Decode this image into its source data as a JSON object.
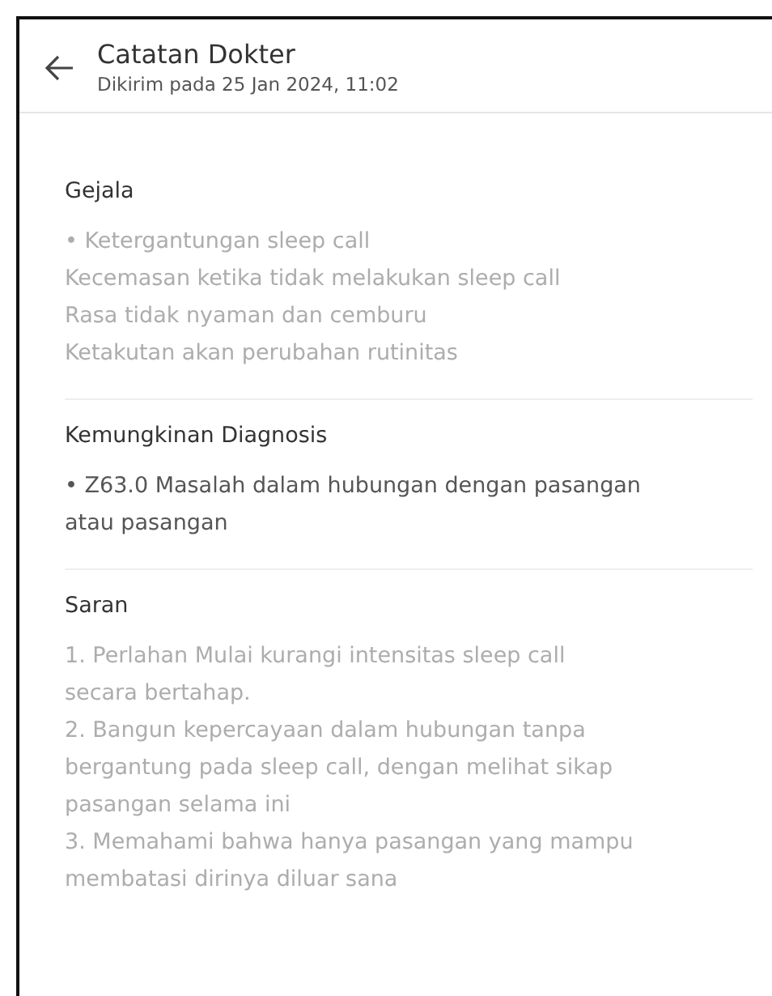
{
  "header": {
    "title": "Catatan Dokter",
    "subtitle": "Dikirim pada 25 Jan 2024, 11:02"
  },
  "sections": [
    {
      "title": "Gejala",
      "muted": true,
      "lines": [
        "• Ketergantungan sleep call",
        "Kecemasan ketika tidak melakukan sleep call",
        "Rasa tidak nyaman dan cemburu",
        "Ketakutan akan perubahan rutinitas"
      ]
    },
    {
      "title": "Kemungkinan Diagnosis",
      "muted": false,
      "lines": [
        "• Z63.0 Masalah dalam hubungan dengan pasangan",
        "atau pasangan"
      ]
    },
    {
      "title": "Saran",
      "muted": true,
      "lines": [
        "1. Perlahan Mulai kurangi intensitas sleep call",
        "secara bertahap.",
        "2. Bangun kepercayaan dalam hubungan tanpa",
        "bergantung pada sleep call, dengan melihat sikap",
        "pasangan selama ini",
        "3. Memahami bahwa hanya pasangan yang mampu",
        "membatasi dirinya diluar sana"
      ]
    }
  ]
}
